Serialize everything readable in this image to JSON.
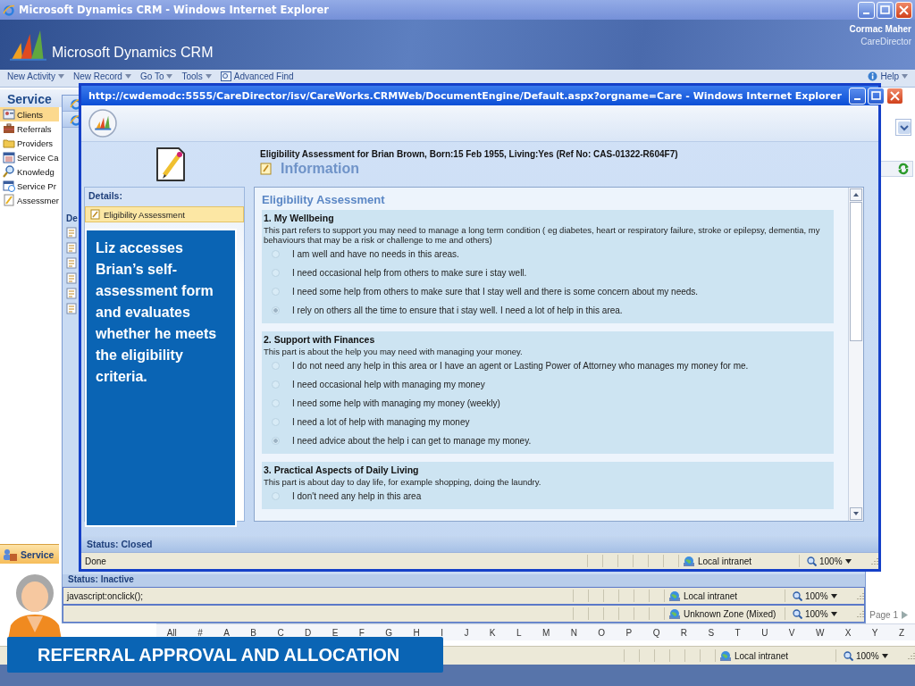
{
  "main_window": {
    "title": "Microsoft Dynamics CRM - Windows Internet Explorer",
    "product": "Microsoft Dynamics CRM",
    "user": "Cormac Maher",
    "organization": "CareDirector",
    "menu": [
      {
        "label": "New Activity",
        "kind": "menu"
      },
      {
        "label": "New Record",
        "kind": "menu"
      },
      {
        "label": "Go To",
        "kind": "menu"
      },
      {
        "label": "Tools",
        "kind": "menu"
      },
      {
        "label": "Advanced Find",
        "kind": "find"
      },
      {
        "label": "Help",
        "kind": "help"
      }
    ],
    "nav": {
      "title": "Service",
      "items": [
        {
          "label": "Clients",
          "selected": true
        },
        {
          "label": "Referrals",
          "selected": false
        },
        {
          "label": "Providers",
          "selected": false
        },
        {
          "label": "Service Ca",
          "selected": false
        },
        {
          "label": "Knowledg",
          "selected": false
        },
        {
          "label": "Service Pr",
          "selected": false
        },
        {
          "label": "Assessmer",
          "selected": false
        }
      ]
    },
    "bottom_nav": {
      "label": "Service"
    },
    "page": "Page 1",
    "letters": [
      "All",
      "#",
      "A",
      "B",
      "C",
      "D",
      "E",
      "F",
      "G",
      "H",
      "I",
      "J",
      "K",
      "L",
      "M",
      "N",
      "O",
      "P",
      "Q",
      "R",
      "S",
      "T",
      "U",
      "V",
      "W",
      "X",
      "Y",
      "Z"
    ],
    "status_bar": {
      "zone": "Local intranet",
      "zoom": "100%"
    }
  },
  "middle_window": {
    "section_label": "De",
    "record_status": "Status: Inactive",
    "status_bar": {
      "text": "javascript:onclick();",
      "zone": "Local intranet",
      "zoom": "100%"
    }
  },
  "back_window": {
    "status_bar": {
      "zone": "Unknown Zone (Mixed)",
      "zoom": "100%"
    }
  },
  "popup": {
    "title": "http://cwdemodc:5555/CareDirector/isv/CareWorks.CRMWeb/DocumentEngine/Default.aspx?orgname=Care - Windows Internet Explorer",
    "record_title": "Eligibility Assessment for Brian Brown, Born:15 Feb 1955, Living:Yes (Ref No: CAS-01322-R604F7)",
    "tab_title": "Information",
    "details_label": "Details:",
    "details_items": [
      {
        "label": "Eligibility Assessment",
        "selected": true
      }
    ],
    "form_title": "Eligibility Assessment",
    "sections": [
      {
        "heading": "1. My Wellbeing",
        "description": "This part refers to support you may need to manage a long term condition ( eg diabetes, heart or respiratory failure, stroke or epilepsy, dementia, my behaviours that may be a risk or challenge to me and others)",
        "options": [
          {
            "label": "I am well and have no needs in this areas.",
            "selected": false
          },
          {
            "label": "I need occasional help from others to make sure i stay well.",
            "selected": false
          },
          {
            "label": "I need some help from others to make sure that I stay well and there is some concern about my needs.",
            "selected": false
          },
          {
            "label": "I rely on others all the time to ensure that i stay well. I need a lot of help in this area.",
            "selected": true
          }
        ]
      },
      {
        "heading": "2. Support with Finances",
        "description": "This part is about the help you may need with managing your money.",
        "options": [
          {
            "label": "I do not need any help in this area or I have an agent or Lasting Power of Attorney who manages my money for me.",
            "selected": false
          },
          {
            "label": "I need occasional help with managing my money",
            "selected": false
          },
          {
            "label": "I need some help with managing my money (weekly)",
            "selected": false
          },
          {
            "label": "I need a lot of help with managing my money",
            "selected": false
          },
          {
            "label": "I need advice about the help i can get to manage my money.",
            "selected": true
          }
        ]
      },
      {
        "heading": "3. Practical Aspects of Daily Living",
        "description": "This part is about day to day life, for example shopping, doing the laundry.",
        "options": [
          {
            "label": "I don't need any help in this area",
            "selected": false
          }
        ]
      }
    ],
    "record_status": "Status: Closed",
    "status_bar": {
      "text": "Done",
      "zone": "Local intranet",
      "zoom": "100%"
    }
  },
  "callout": "Liz accesses Brian’s self-assessment form and evaluates whether he meets the eligibility criteria.",
  "banner": "REFERRAL APPROVAL AND ALLOCATION"
}
